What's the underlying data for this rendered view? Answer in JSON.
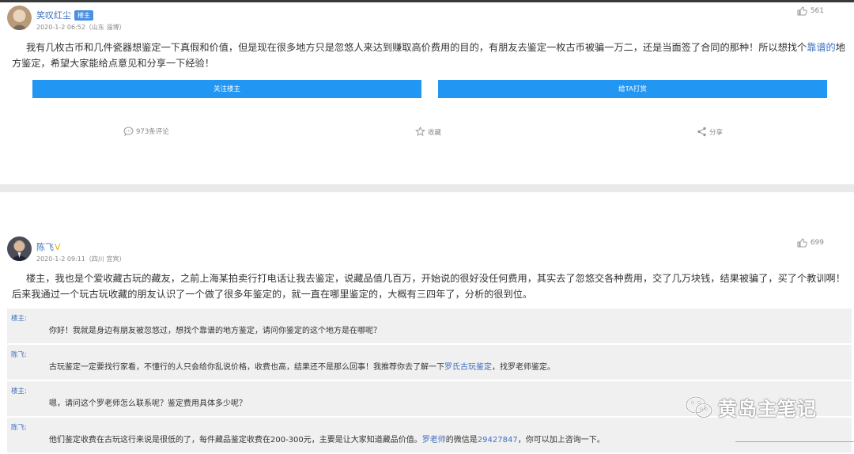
{
  "post1": {
    "username": "笑叹红尘",
    "badge": "楼主",
    "meta": "2020-1-2 06:52（山东 淄博）",
    "likes": "561",
    "body_pre": "我有几枚古币和几件瓷器想鉴定一下真假和价值，但是现在很多地方只是忽悠人来达到赚取高价费用的目的，有朋友去鉴定一枚古币被骗一万二，还是当面签了合同的那种！所以想找个",
    "body_link": "靠谱的",
    "body_post": "地方鉴定，希望大家能给点意见和分享一下经验！",
    "follow_label": "关注楼主",
    "tip_label": "给TA打赏",
    "comments_label": "973条评论",
    "favorite_label": "收藏",
    "share_label": "分享"
  },
  "post2": {
    "username": "陈飞",
    "meta": "2020-1-2 09:11（四川 宜宾）",
    "likes": "699",
    "body": "楼主，我也是个爱收藏古玩的藏友，之前上海某拍卖行打电话让我去鉴定，说藏品值几百万，开始说的很好没任何费用，其实去了忽悠交各种费用，交了几万块钱，结果被骗了，买了个教训啊！后来我通过一个玩古玩收藏的朋友认识了一个做了很多年鉴定的，就一直在哪里鉴定的，大概有三四年了，分析的很到位。",
    "replies": [
      {
        "who": "楼主:",
        "pre": "你好！我就是身边有朋友被忽悠过，想找个靠谱的地方鉴定，请问你鉴定的这个地方是在哪呢？",
        "link": "",
        "post": ""
      },
      {
        "who": "陈飞:",
        "pre": "古玩鉴定一定要找行家看，不懂行的人只会给你乱说价格，收费也高，结果还不是那么回事！我推荐你去了解一下",
        "link": "罗氏古玩鉴定",
        "post": "，找罗老师鉴定。"
      },
      {
        "who": "楼主:",
        "pre": "嗯，请问这个罗老师怎么联系呢？鉴定费用具体多少呢？",
        "link": "",
        "post": ""
      },
      {
        "who": "陈飞:",
        "pre": "他们鉴定收费在古玩这行来说是很低的了，每件藏品鉴定收费在200-300元，主要是让大家知道藏品价值。",
        "link": "罗老师",
        "post": "的微信是",
        "link2": "29427847",
        "post2": "，你可以加上咨询一下。"
      }
    ]
  },
  "watermark": "黄岛主笔记",
  "colors": {
    "accent": "#2196f3",
    "link": "#3f6fbf",
    "reply_bg": "#f0f0f0"
  }
}
